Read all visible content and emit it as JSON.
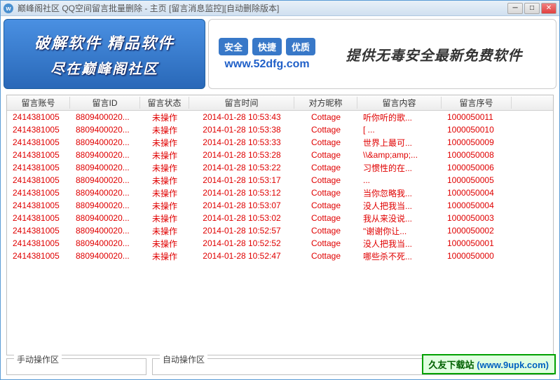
{
  "titlebar": {
    "icon_letter": "w",
    "text": "巅峰阁社区 QQ空间留言批量删除 - 主页 [留言消息监控][自动删除版本]"
  },
  "banner": {
    "left_line1": "破解软件 精品软件",
    "left_line2": "尽在巅峰阁社区",
    "pills": [
      "安全",
      "快捷",
      "优质"
    ],
    "right_text": "提供无毒安全最新免费软件",
    "url": "www.52dfg.com"
  },
  "table": {
    "columns": [
      "留言账号",
      "留言ID",
      "留言状态",
      "留言时间",
      "对方昵称",
      "留言内容",
      "留言序号"
    ],
    "rows": [
      [
        "2414381005",
        "8809400020...",
        "未操作",
        "2014-01-28 10:53:43",
        "Cottage",
        "听你听的歌...",
        "1000050011"
      ],
      [
        "2414381005",
        "8809400020...",
        "未操作",
        "2014-01-28 10:53:38",
        "Cottage",
        "[          ...",
        "1000050010"
      ],
      [
        "2414381005",
        "8809400020...",
        "未操作",
        "2014-01-28 10:53:33",
        "Cottage",
        "世界上最可...",
        "1000050009"
      ],
      [
        "2414381005",
        "8809400020...",
        "未操作",
        "2014-01-28 10:53:28",
        "Cottage",
        "\\\\&amp;amp;...",
        "1000050008"
      ],
      [
        "2414381005",
        "8809400020...",
        "未操作",
        "2014-01-28 10:53:22",
        "Cottage",
        "习惯性的在...",
        "1000050006"
      ],
      [
        "2414381005",
        "8809400020...",
        "未操作",
        "2014-01-28 10:53:17",
        "Cottage",
        "       ...",
        "1000050005"
      ],
      [
        "2414381005",
        "8809400020...",
        "未操作",
        "2014-01-28 10:53:12",
        "Cottage",
        "当你忽略我...",
        "1000050004"
      ],
      [
        "2414381005",
        "8809400020...",
        "未操作",
        "2014-01-28 10:53:07",
        "Cottage",
        "没人把我当...",
        "1000050004"
      ],
      [
        "2414381005",
        "8809400020...",
        "未操作",
        "2014-01-28 10:53:02",
        "Cottage",
        "我从来没说...",
        "1000050003"
      ],
      [
        "2414381005",
        "8809400020...",
        "未操作",
        "2014-01-28 10:52:57",
        "Cottage",
        "\"谢谢你让...",
        "1000050002"
      ],
      [
        "2414381005",
        "8809400020...",
        "未操作",
        "2014-01-28 10:52:52",
        "Cottage",
        "没人把我当...",
        "1000050001"
      ],
      [
        "2414381005",
        "8809400020...",
        "未操作",
        "2014-01-28 10:52:47",
        "Cottage",
        "哪些杀不死...",
        "1000050000"
      ]
    ]
  },
  "panels": {
    "manual": "手动操作区",
    "auto": "自动操作区"
  },
  "watermark": {
    "site_name": "久友下载站",
    "url_text": "(www.9upk.com)"
  }
}
